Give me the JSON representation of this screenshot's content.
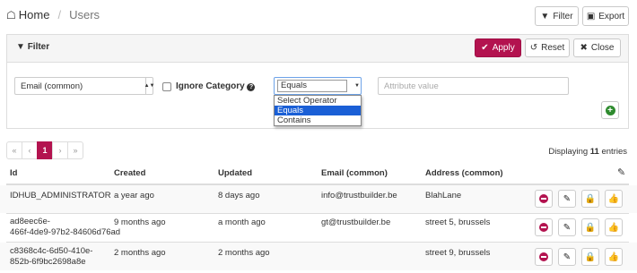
{
  "breadcrumb": {
    "home": "Home",
    "current": "Users"
  },
  "toolbar": {
    "filter_label": "Filter",
    "export_label": "Export"
  },
  "filter_panel": {
    "title": "Filter",
    "apply_label": "Apply",
    "reset_label": "Reset",
    "close_label": "Close",
    "attribute_select_value": "Email (common)",
    "ignore_category_label": "Ignore Category",
    "operator_value": "Equals",
    "operator_options": [
      "Select Operator",
      "Equals",
      "Contains"
    ],
    "attribute_value_placeholder": "Attribute value"
  },
  "pagination": {
    "first": "«",
    "prev": "‹",
    "current": "1",
    "next": "›",
    "last": "»"
  },
  "entries": {
    "prefix": "Displaying ",
    "count": "11",
    "suffix": " entries"
  },
  "table": {
    "columns": [
      "Id",
      "Created",
      "Updated",
      "Email (common)",
      "Address (common)"
    ],
    "rows": [
      {
        "id": "IDHUB_ADMINISTRATOR",
        "created": "a year ago",
        "updated": "8 days ago",
        "email": "info@trustbuilder.be",
        "address": "BlahLane"
      },
      {
        "id": "ad8eec6e-466f-4de9-97b2-84606d76ad",
        "id_line1": "ad8eec6e-",
        "id_line2": "466f-4de9-97b2-84606d76ad",
        "created": "9 months ago",
        "updated": "a month ago",
        "email": "gt@trustbuilder.be",
        "address": "street 5, brussels"
      },
      {
        "id": "c8368c4c-6d50-410e-852b-6f9bc2698a8e",
        "id_line1": "c8368c4c-6d50-410e-",
        "id_line2": "852b-6f9bc2698a8e",
        "created": "2 months ago",
        "updated": "2 months ago",
        "email": "",
        "address": "street 9, brussels"
      }
    ]
  },
  "colors": {
    "accent": "#b3134f",
    "dropdown_highlight": "#1a5fd6"
  }
}
